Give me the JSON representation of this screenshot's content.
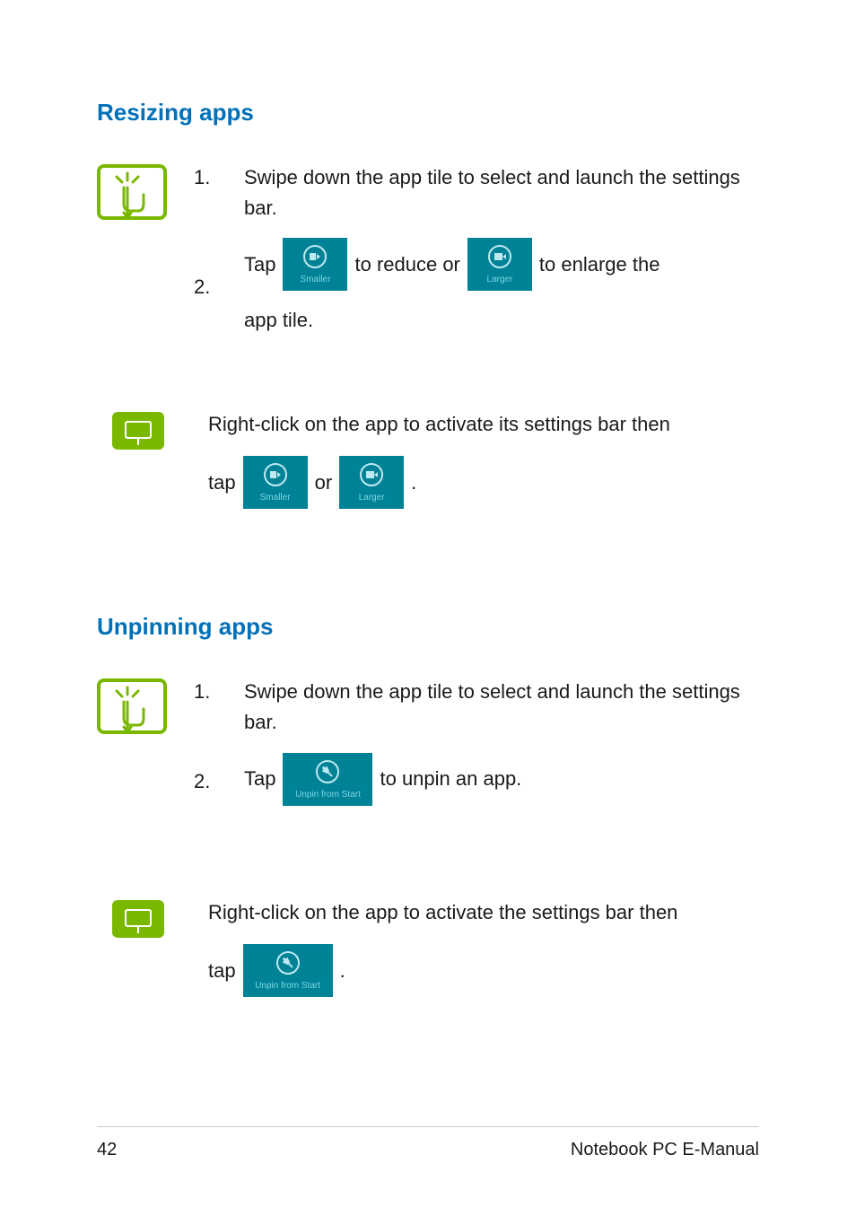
{
  "headings": {
    "resizing": "Resizing apps",
    "unpinning": "Unpinning apps"
  },
  "resizing": {
    "touch_step1_num": "1.",
    "touch_step1_text": "Swipe down the app tile to select and launch the settings bar.",
    "touch_step2_num": "2.",
    "touch_step2_pre": "Tap",
    "touch_step2_mid": "to reduce or",
    "touch_step2_post": "to enlarge the",
    "touch_step2_line2": "app tile.",
    "pad_line1": "Right-click on the app to activate its settings bar then",
    "pad_line2_pre": "tap",
    "pad_line2_mid": "or",
    "pad_line2_post": "."
  },
  "unpinning": {
    "touch_step1_num": "1.",
    "touch_step1_text": "Swipe down the app tile to select and launch the settings bar.",
    "touch_step2_num": "2.",
    "touch_step2_pre": "Tap",
    "touch_step2_post": "to unpin an app.",
    "pad_line1": "Right-click on the app to activate the settings bar then",
    "pad_line2_pre": "tap",
    "pad_line2_post": "."
  },
  "buttons": {
    "smaller_label": "Smaller",
    "larger_label": "Larger",
    "unpin_label": "Unpin from Start"
  },
  "footer": {
    "page_number": "42",
    "doc_title": "Notebook PC E-Manual"
  }
}
